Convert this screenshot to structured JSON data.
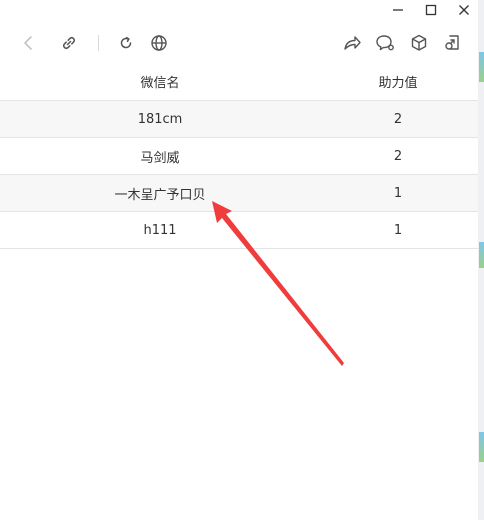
{
  "window_controls": [
    {
      "name": "minimize-button",
      "icon": "minimize-icon"
    },
    {
      "name": "maximize-button",
      "icon": "maximize-icon"
    },
    {
      "name": "close-button",
      "icon": "close-icon"
    }
  ],
  "toolbar": {
    "left_icons": [
      "back-icon",
      "link-icon",
      "refresh-icon",
      "globe-icon"
    ],
    "right_icons": [
      "share-icon",
      "chat-bubble-icon",
      "cube-icon",
      "open-external-icon"
    ]
  },
  "table": {
    "headers": [
      "微信名",
      "助力值"
    ],
    "rows": [
      {
        "name": "181cm",
        "value": "2"
      },
      {
        "name": "马剑威",
        "value": "2"
      },
      {
        "name": "一木呈广予口贝",
        "value": "1"
      },
      {
        "name": "h111",
        "value": "1"
      }
    ]
  },
  "colors": {
    "annotation_arrow": "#f03c3c",
    "stripe": "#f7f7f7",
    "icon": "#555555"
  }
}
